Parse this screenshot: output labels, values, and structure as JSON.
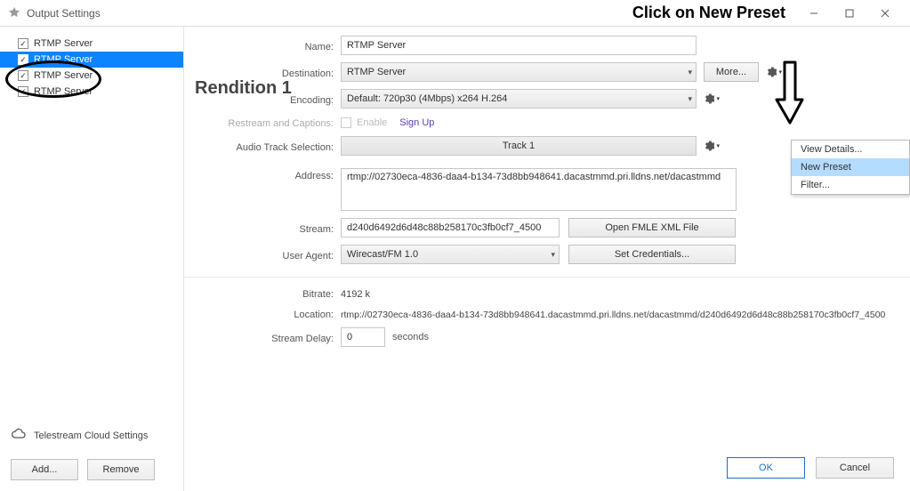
{
  "window": {
    "title": "Output Settings",
    "annotation": "Click on New Preset"
  },
  "sidebar": {
    "items": [
      {
        "label": "RTMP Server",
        "checked": true,
        "selected": false
      },
      {
        "label": "RTMP Server",
        "checked": true,
        "selected": true
      },
      {
        "label": "RTMP Server",
        "checked": true,
        "selected": false
      },
      {
        "label": "RTMP Server",
        "checked": true,
        "selected": false
      }
    ],
    "cloud_label": "Telestream Cloud Settings",
    "add_label": "Add...",
    "remove_label": "Remove"
  },
  "rendition": {
    "title": "Rendition 1",
    "labels": {
      "name": "Name:",
      "destination": "Destination:",
      "encoding": "Encoding:",
      "restream": "Restream and Captions:",
      "audio_track": "Audio Track Selection:",
      "address": "Address:",
      "stream": "Stream:",
      "user_agent": "User Agent:",
      "bitrate": "Bitrate:",
      "location": "Location:",
      "stream_delay": "Stream Delay:"
    },
    "name_value": "RTMP Server",
    "destination_value": "RTMP Server",
    "more_label": "More...",
    "encoding_value": "Default: 720p30 (4Mbps) x264 H.264",
    "enable_label": "Enable",
    "signup_label": "Sign Up",
    "track_label": "Track 1",
    "address_value": "rtmp://02730eca-4836-daa4-b134-73d8bb948641.dacastmmd.pri.lldns.net/dacastmmd",
    "stream_value": "d240d6492d6d48c88b258170c3fb0cf7_4500",
    "open_fmle_label": "Open FMLE XML File",
    "user_agent_value": "Wirecast/FM 1.0",
    "set_credentials_label": "Set Credentials...",
    "bitrate_value": "4192 k",
    "location_value": "rtmp://02730eca-4836-daa4-b134-73d8bb948641.dacastmmd.pri.lldns.net/dacastmmd/d240d6492d6d48c88b258170c3fb0cf7_4500",
    "stream_delay_value": "0",
    "seconds_label": "seconds"
  },
  "encoding_menu": {
    "view_details": "View Details...",
    "new_preset": "New Preset",
    "filter": "Filter..."
  },
  "footer": {
    "ok": "OK",
    "cancel": "Cancel"
  }
}
